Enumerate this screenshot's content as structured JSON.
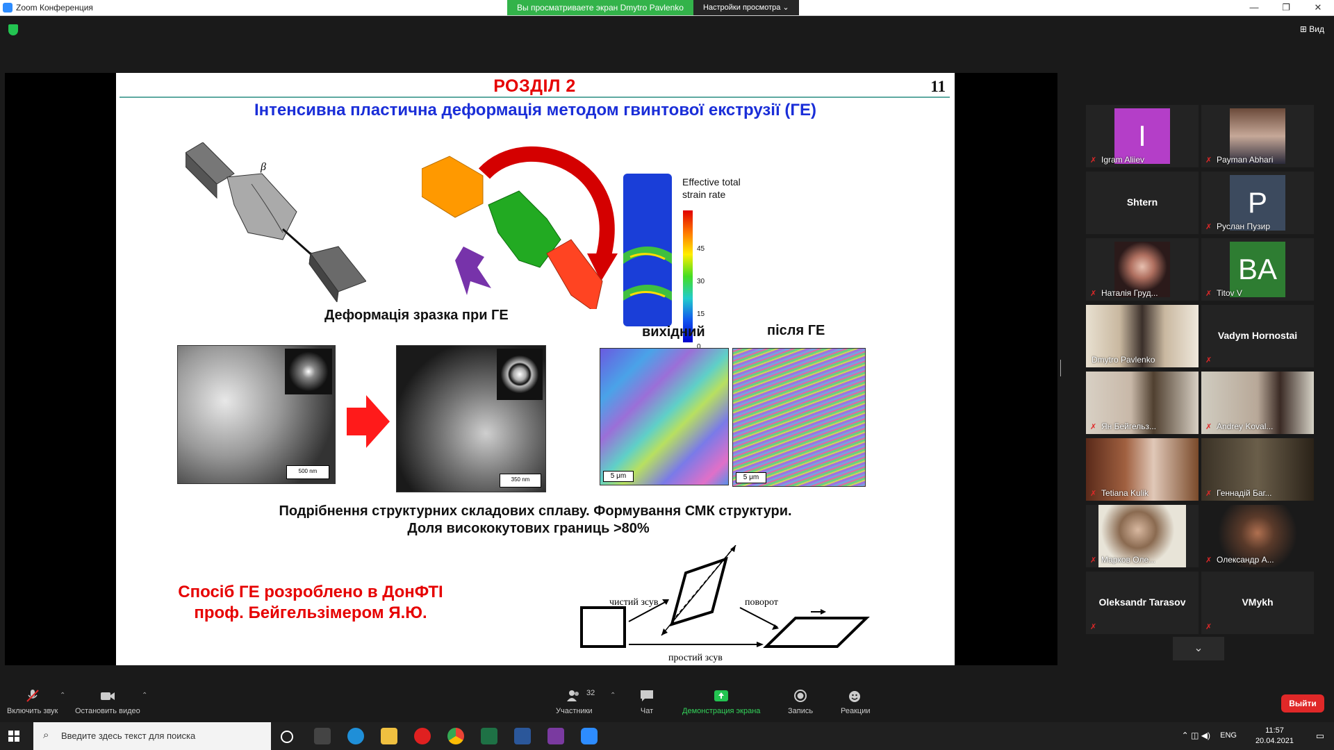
{
  "window": {
    "title": "Zoom Конференция",
    "share_banner": "Вы просматриваете экран Dmytro Pavlenko",
    "view_options": "Настройки просмотра",
    "view_button": "Вид"
  },
  "slide": {
    "section": "РОЗДІЛ 2",
    "page_number": "11",
    "subtitle": "Інтенсивна пластична деформація методом гвинтової екструзії (ГЕ)",
    "deformation_caption": "Деформація зразка при ГЕ",
    "beta_label": "β",
    "strain_title_line1": "Effective total",
    "strain_title_line2": "strain rate",
    "strain_ticks": [
      "45",
      "30",
      "15",
      "0"
    ],
    "label_initial": "вихідний",
    "label_after": "після ГЕ",
    "scale_500": "500 nm",
    "scale_350": "350 nm",
    "scale_5um_a": "5 μm",
    "scale_5um_b": "5 μm",
    "result_line1": "Подрібнення структурних складових сплаву. Формування СМК структури.",
    "result_line2": "Доля висококутових границь >80%",
    "author_line1": "Спосіб ГЕ розроблено в ДонФТІ",
    "author_line2": "проф. Бейгельзімером Я.Ю.",
    "diagram_pure_shear": "чистий зсув",
    "diagram_rotation": "поворот",
    "diagram_simple_shear": "простий зсув"
  },
  "participants": [
    {
      "name": "Igram Aliiev",
      "type": "letter",
      "letter": "I",
      "color": "#b43ec8",
      "muted": true
    },
    {
      "name": "Payman Abhari",
      "type": "photo",
      "muted": true
    },
    {
      "name": "Shtern",
      "type": "name",
      "muted": false
    },
    {
      "name": "Руслан Пузир",
      "type": "letter",
      "letter": "P",
      "color": "#3c4a5e",
      "muted": true
    },
    {
      "name": "Наталія Груд...",
      "type": "photo",
      "muted": true
    },
    {
      "name": "Titov V",
      "type": "letter",
      "letter": "BA",
      "color": "#2e7d32",
      "muted": true
    },
    {
      "name": "Dmytro Pavlenko",
      "type": "photo",
      "muted": false,
      "active": true
    },
    {
      "name": "Vadym Hornostai",
      "type": "name",
      "muted": true
    },
    {
      "name": "Ян Бейгельз...",
      "type": "photo",
      "muted": true
    },
    {
      "name": "Andrey Koval...",
      "type": "photo",
      "muted": true
    },
    {
      "name": "Tetiana Kulik",
      "type": "photo",
      "muted": true
    },
    {
      "name": "Геннадій Баг...",
      "type": "photo",
      "muted": true
    },
    {
      "name": "Марков Оле...",
      "type": "photo",
      "muted": true
    },
    {
      "name": "Олександр А...",
      "type": "photo",
      "muted": true
    },
    {
      "name": "Oleksandr Tarasov",
      "type": "name",
      "muted": true
    },
    {
      "name": "VMykh",
      "type": "name",
      "muted": true
    }
  ],
  "toolbar": {
    "unmute": "Включить звук",
    "stop_video": "Остановить видео",
    "participants": "Участники",
    "participants_count": "32",
    "chat": "Чат",
    "share_screen": "Демонстрация экрана",
    "record": "Запись",
    "reactions": "Реакции",
    "leave": "Выйти"
  },
  "taskbar": {
    "search_placeholder": "Введите здесь текст для поиска",
    "language": "ENG",
    "time": "11:57",
    "date": "20.04.2021"
  },
  "colors": {
    "zoom_blue": "#2d8cff",
    "share_green": "#33b34a",
    "leave_red": "#e02828",
    "slide_red": "#e60000",
    "slide_blue": "#1a2ed8",
    "active_speaker": "#d6f22f"
  }
}
